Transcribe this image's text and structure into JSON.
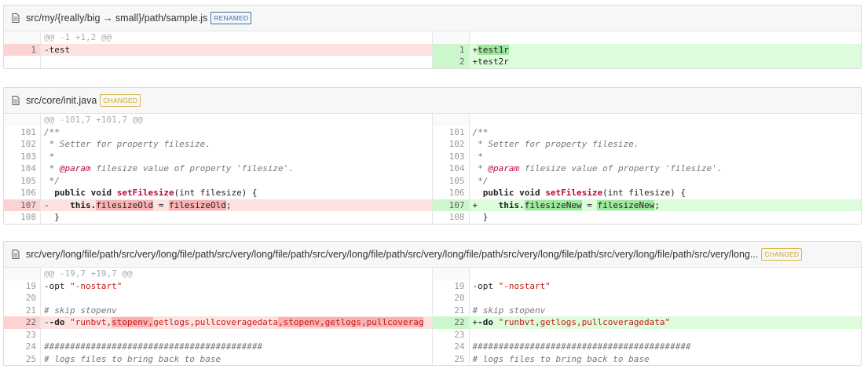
{
  "files": [
    {
      "path": "src/my/{really/big → small}/path/sample.js",
      "tag": "RENAMED",
      "hunk": "@@ -1 +1,2 @@",
      "left": [
        {
          "n": "1",
          "t": "-test"
        }
      ],
      "right": [
        {
          "n": "1",
          "t": "+test1r"
        },
        {
          "n": "2",
          "t": "+test2r"
        }
      ]
    },
    {
      "path": "src/core/init.java",
      "tag": "CHANGED",
      "hunk": "@@ -101,7 +101,7 @@",
      "lines": {
        "n": [
          "101",
          "102",
          "103",
          "104",
          "105",
          "106",
          "107",
          "108"
        ],
        "c101": "/**",
        "c102": " * Setter for property filesize.",
        "c103": " *",
        "c104_tag": "@param",
        "c104_rest": " filesize value of property 'filesize'.",
        "c105": " */",
        "c106_kw": "public void ",
        "c106_fn": "setFilesize",
        "c106_rest": "(int filesize) {",
        "c107_left_prefix": "-",
        "c107_left_kw": "this.",
        "c107_left_a": "filesizeOld",
        "c107_left_mid": " = ",
        "c107_left_b": "filesizeOld",
        "c107_left_end": ";",
        "c107_right_prefix": "+",
        "c107_right_kw": "this.",
        "c107_right_a": "filesizeNew",
        "c107_right_mid": " = ",
        "c107_right_b": "filesizeNew",
        "c107_right_end": ";",
        "c108": "}"
      }
    },
    {
      "path": "src/very/long/file/path/src/very/long/file/path/src/very/long/file/path/src/very/long/file/path/src/very/long/file/path/src/very/long/file/path/src/very/long/file/path/src/very/long...",
      "tag": "CHANGED",
      "hunk": "@@ -19,7 +19,7 @@",
      "lines": {
        "n": [
          "19",
          "20",
          "21",
          "22",
          "23",
          "24",
          "25"
        ],
        "c19_opt": "-opt ",
        "c19_str": "\"-nostart\"",
        "c21": "# skip stopenv",
        "c22_left_prefix": "-",
        "c22_left_kw": "-do ",
        "c22_left_s1": "\"runbvt,",
        "c22_left_h1": "stopenv,",
        "c22_left_s2": "getlogs,pullcoveragedata",
        "c22_left_h2": ",stopenv,getlogs,pullcoverag",
        "c22_right_prefix": "+",
        "c22_right_kw": "-do ",
        "c22_right_s": "\"runbvt,getlogs,pullcoveragedata\"",
        "c24": "##########################################",
        "c25": "# logs files to bring back to base"
      }
    }
  ]
}
